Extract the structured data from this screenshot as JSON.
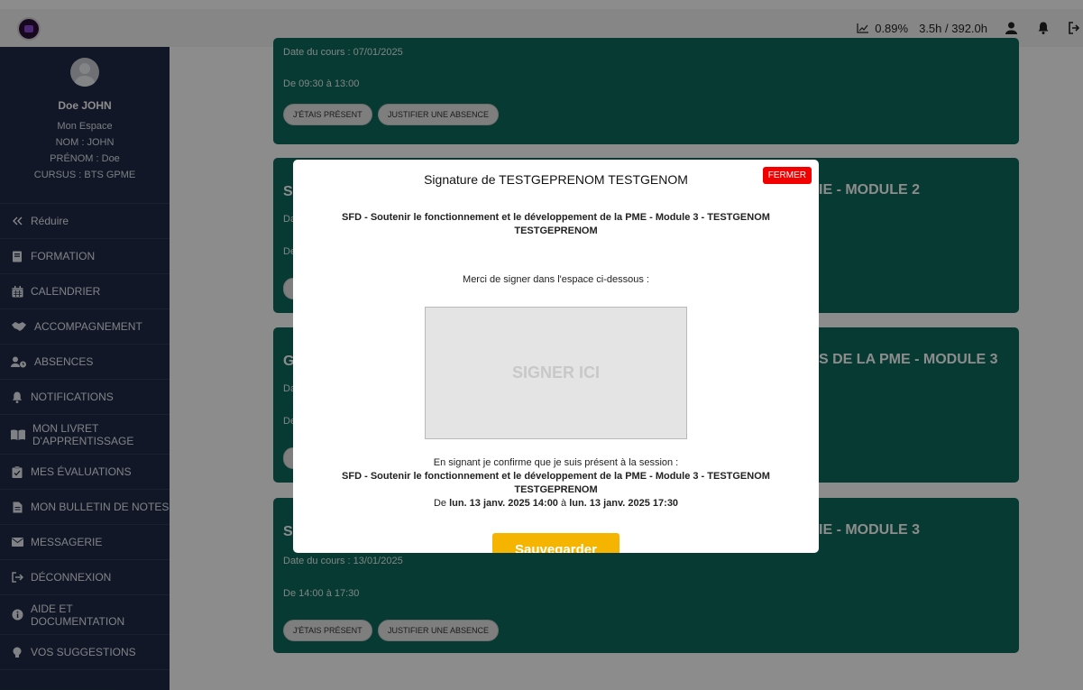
{
  "topbar": {
    "progress_percent": "0.89%",
    "hours": "3.5h / 392.0h"
  },
  "profile": {
    "name": "Doe JOHN",
    "space": "Mon Espace",
    "nom": "NOM : JOHN",
    "prenom": "PRÉNOM : Doe",
    "cursus": "CURSUS : BTS GPME"
  },
  "sidebar": {
    "items": [
      {
        "label": "Réduire",
        "icon": "double-chevron-left-icon"
      },
      {
        "label": "FORMATION",
        "icon": "book-icon"
      },
      {
        "label": "CALENDRIER",
        "icon": "calendar-icon"
      },
      {
        "label": "ACCOMPAGNEMENT",
        "icon": "handshake-icon"
      },
      {
        "label": "ABSENCES",
        "icon": "user-clock-icon"
      },
      {
        "label": "NOTIFICATIONS",
        "icon": "bell-icon"
      },
      {
        "label": "MON LIVRET D'APPRENTISSAGE",
        "icon": "open-book-icon"
      },
      {
        "label": "MES ÉVALUATIONS",
        "icon": "clipboard-check-icon"
      },
      {
        "label": "MON BULLETIN DE NOTES",
        "icon": "file-icon"
      },
      {
        "label": "MESSAGERIE",
        "icon": "envelope-icon"
      },
      {
        "label": "DÉCONNEXION",
        "icon": "sign-out-icon"
      },
      {
        "label": "AIDE ET DOCUMENTATION",
        "icon": "info-circle-icon"
      },
      {
        "label": "VOS SUGGESTIONS",
        "icon": "lightbulb-icon"
      }
    ]
  },
  "cards": [
    {
      "date": "Date du cours : 07/01/2025",
      "time": "De 09:30 à 13:00",
      "present_label": "J'ÉTAIS PRÉSENT",
      "justify_label": "JUSTIFIER UNE ABSENCE"
    },
    {
      "title_left": "S",
      "title_right": "IE - MODULE 2",
      "line1": "Da",
      "line2": "De"
    },
    {
      "title_left": "G",
      "title_right": "S DE LA PME - MODULE 3",
      "line1": "Da",
      "line2": "De"
    },
    {
      "title_left": "S",
      "title_right": "IE - MODULE 3",
      "date": "Date du cours : 13/01/2025",
      "time": "De 14:00 à 17:30",
      "present_label": "J'ÉTAIS PRÉSENT",
      "justify_label": "JUSTIFIER UNE ABSENCE"
    }
  ],
  "modal": {
    "title": "Signature de TESTGEPRENOM TESTGENOM",
    "close_label": "FERMER",
    "session_line1": "SFD - Soutenir le fonctionnement et le développement de la PME - Module 3 - TESTGENOM",
    "session_line2": "TESTGEPRENOM",
    "prompt": "Merci de signer dans l'espace ci-dessous :",
    "sign_placeholder": "SIGNER ICI",
    "confirm_intro": "En signant je confirme que je suis présent à la session :",
    "confirm_session_line1": "SFD - Soutenir le fonctionnement et le développement de la PME - Module 3 - TESTGENOM",
    "confirm_session_line2": "TESTGEPRENOM",
    "confirm_de": "De",
    "confirm_start": "lun. 13 janv. 2025 14:00",
    "confirm_a": "à",
    "confirm_end": "lun. 13 janv. 2025 17:30",
    "save_label": "Sauvegarder"
  },
  "colors": {
    "sidebar": "#1f2b45",
    "card": "#0e6b5b",
    "close": "#f20000",
    "save": "#f4b400"
  }
}
